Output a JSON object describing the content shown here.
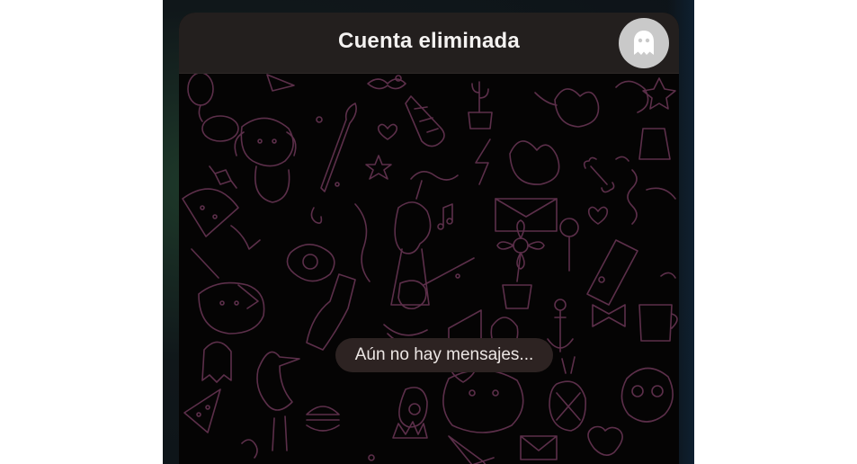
{
  "header": {
    "title": "Cuenta eliminada",
    "avatar_icon": "ghost-icon"
  },
  "chat": {
    "empty_state": "Aún no hay mensajes...",
    "wallpaper": "doodle-pattern"
  },
  "colors": {
    "header_bg": "#231f1e",
    "chat_bg": "#050404",
    "doodle_stroke": "#5c2f4a",
    "pill_bg": "#2d2322",
    "avatar_bg": "#c9c9c9"
  }
}
